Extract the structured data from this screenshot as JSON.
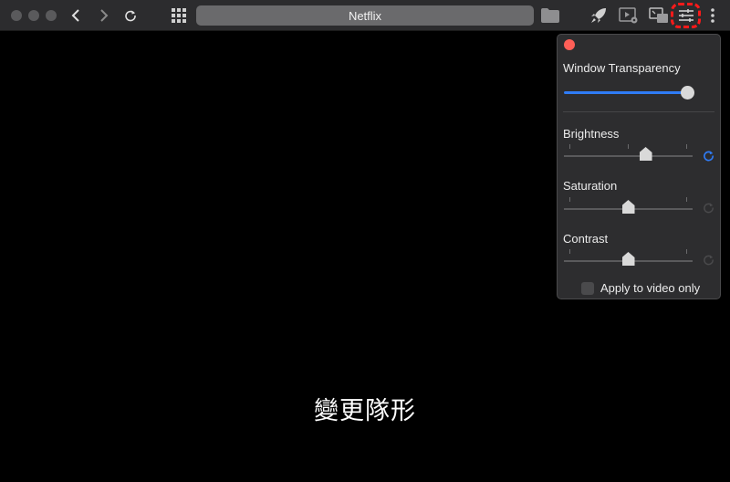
{
  "toolbar": {
    "url_title": "Netflix",
    "icons": {
      "back": "chevron-left-icon",
      "forward": "chevron-right-icon",
      "reload": "reload-icon",
      "apps": "grid-icon",
      "folder": "folder-icon",
      "rocket": "rocket-icon",
      "pip_settings": "pip-settings-icon",
      "mini_player": "mini-player-icon",
      "adjustments": "sliders-icon",
      "more": "more-vertical-icon"
    },
    "highlight_color": "#ff1a1a"
  },
  "panel": {
    "window_transparency": {
      "label": "Window Transparency",
      "value_fraction": 0.95
    },
    "brightness": {
      "label": "Brightness",
      "value_fraction": 0.65,
      "reset_active": true
    },
    "saturation": {
      "label": "Saturation",
      "value_fraction": 0.5,
      "reset_active": false
    },
    "contrast": {
      "label": "Contrast",
      "value_fraction": 0.5,
      "reset_active": false
    },
    "apply_to_video_only": {
      "label": "Apply to video only",
      "checked": false
    },
    "accent_color": "#2f7cf6",
    "close_color": "#ff5f57"
  },
  "video": {
    "subtitle": "變更隊形"
  }
}
